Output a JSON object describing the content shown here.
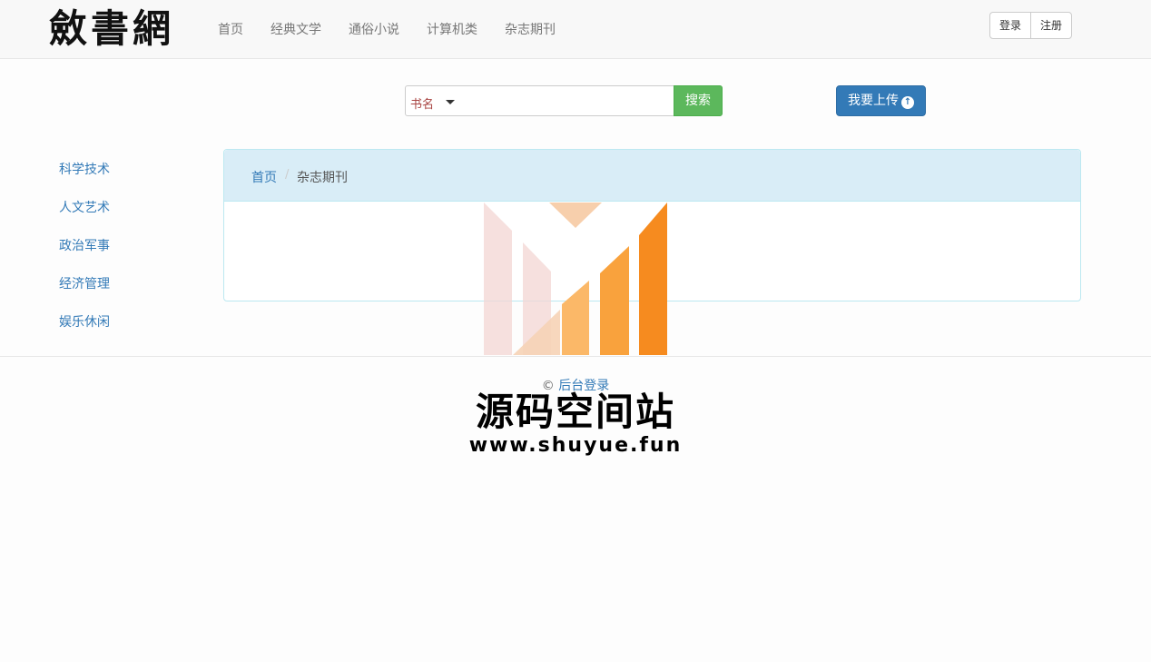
{
  "brand": {
    "logo_text": "斂書網"
  },
  "nav": {
    "items": [
      "首页",
      "经典文学",
      "通俗小说",
      "计算机类",
      "杂志期刊"
    ]
  },
  "auth": {
    "login": "登录",
    "register": "注册"
  },
  "search": {
    "type": "书名",
    "value": "",
    "button": "搜索"
  },
  "upload": {
    "label": "我要上传",
    "icon": "arrow-up-circle-icon"
  },
  "sidebar": {
    "items": [
      "科学技术",
      "人文艺术",
      "政治军事",
      "经济管理",
      "娱乐休闲"
    ]
  },
  "breadcrumb": {
    "home": "首页",
    "separator": "/",
    "current": "杂志期刊"
  },
  "footer": {
    "copyright": "©",
    "admin_link": "后台登录"
  },
  "watermark": {
    "title": "源码空间站",
    "url": "www.shuyue.fun"
  },
  "colors": {
    "primary": "#337ab7",
    "success": "#5cb85c",
    "panel_head": "#d9edf7",
    "watermark_orange": "#f68b1f"
  }
}
